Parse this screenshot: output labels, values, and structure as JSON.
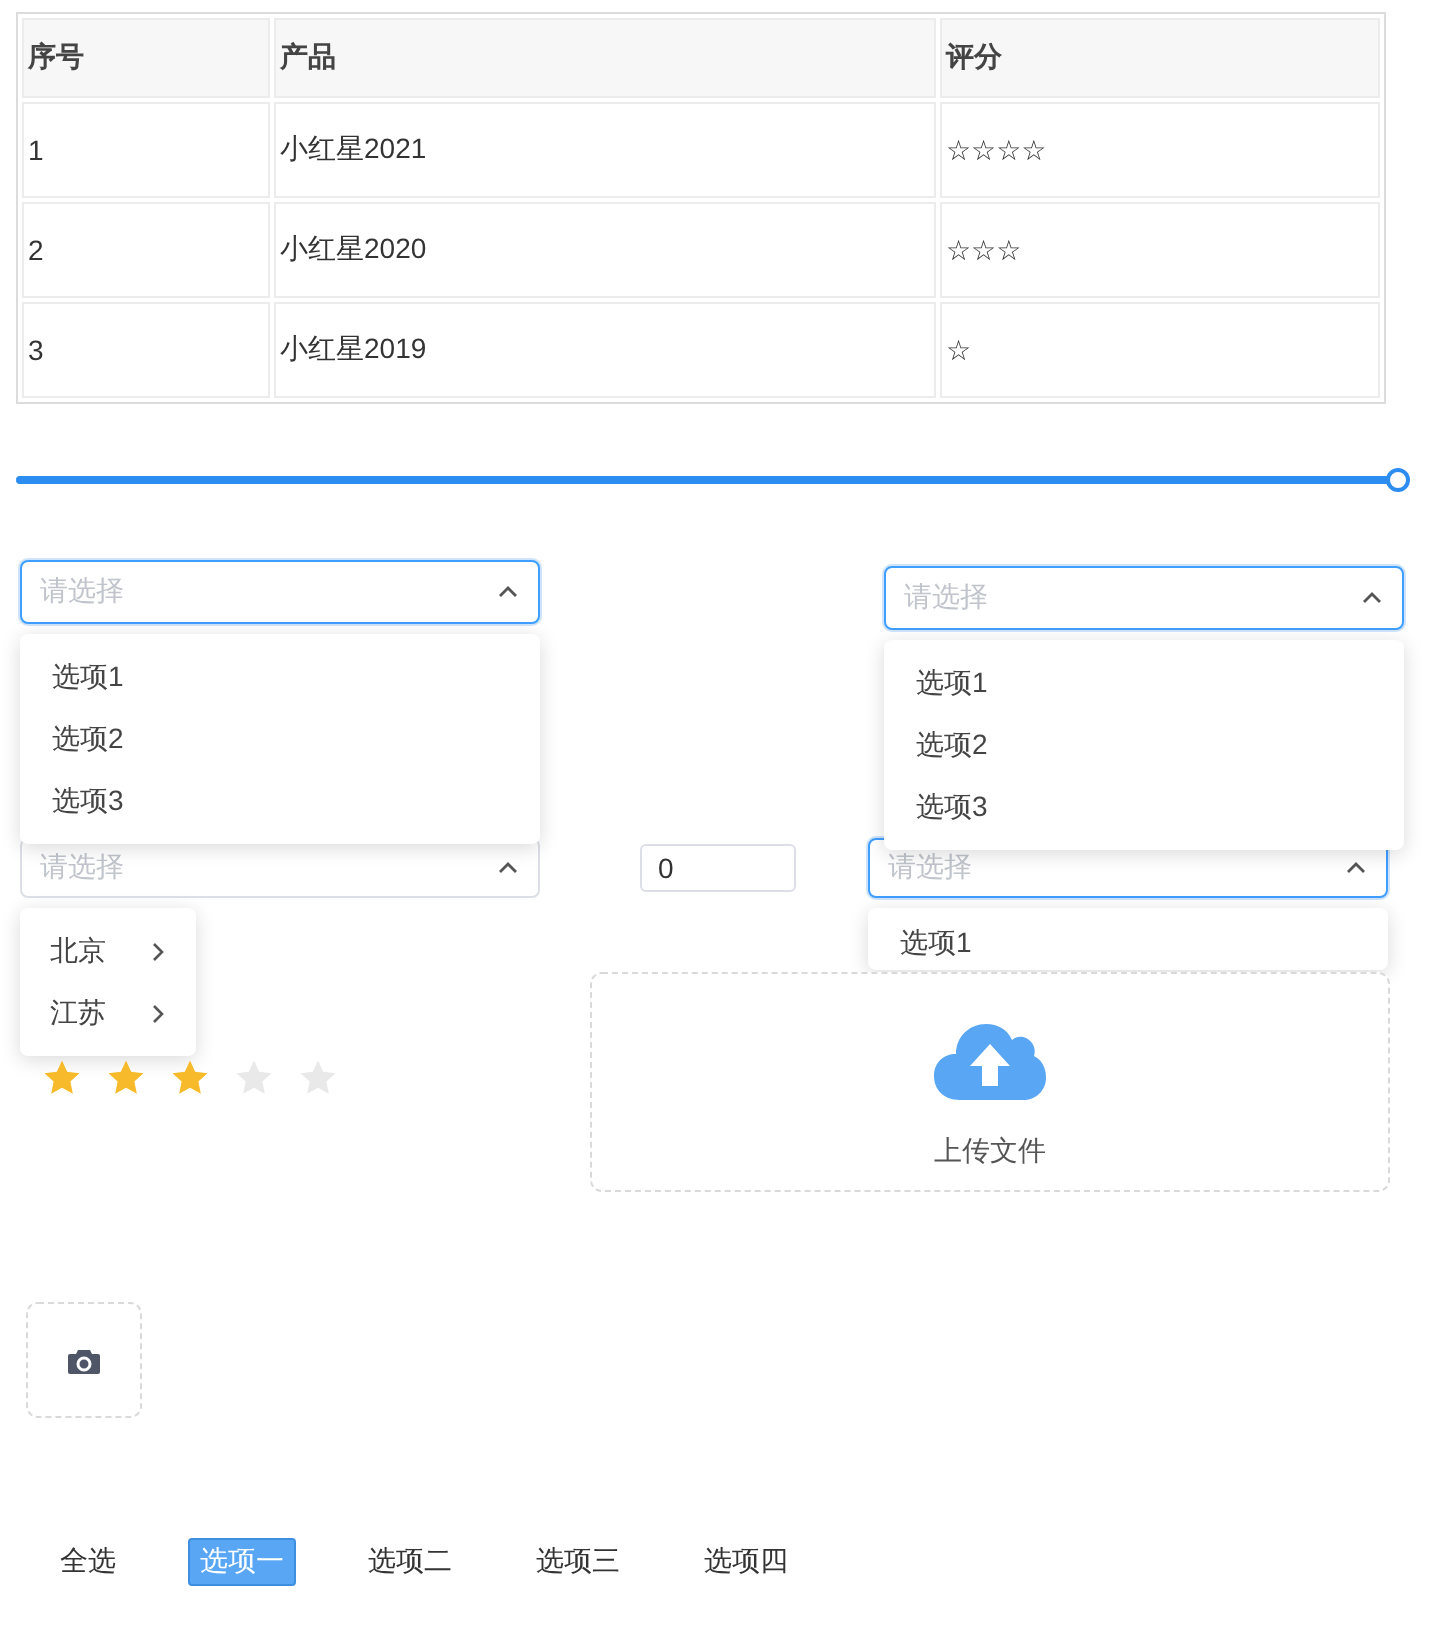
{
  "table": {
    "columns": [
      "序号",
      "产品",
      "评分"
    ],
    "rows": [
      [
        "1",
        "小红星2021",
        "☆☆☆☆"
      ],
      [
        "2",
        "小红星2020",
        "☆☆☆"
      ],
      [
        "3",
        "小红星2019",
        "☆"
      ]
    ]
  },
  "slider": {
    "level": 1
  },
  "top_selects": [
    {
      "placeholder": "请选择",
      "focused": true,
      "expanded": true,
      "options": [
        "选项1",
        "选项2",
        "选项3"
      ]
    },
    {
      "placeholder": "请选择",
      "focused": true,
      "expanded": true,
      "options": [
        "选项1",
        "选项2",
        "选项3"
      ]
    }
  ],
  "cascader": {
    "placeholder": "请选择",
    "focused": false,
    "expanded": true,
    "options": [
      {
        "label": "北京",
        "has_children": true
      },
      {
        "label": "江苏",
        "has_children": true
      }
    ]
  },
  "number_input": {
    "value": "0"
  },
  "bottom_select": {
    "placeholder": "请选择",
    "focused": true,
    "expanded": true,
    "options": [
      "选项1"
    ]
  },
  "rate": {
    "stars": 3
  },
  "upload": {
    "label": "上传文件"
  },
  "checkbox_buttons": [
    {
      "label": "全选",
      "selected": false
    },
    {
      "label": "选项一",
      "selected": true
    },
    {
      "label": "选项二",
      "selected": false
    },
    {
      "label": "选项三",
      "selected": false
    },
    {
      "label": "选项四",
      "selected": false
    }
  ]
}
